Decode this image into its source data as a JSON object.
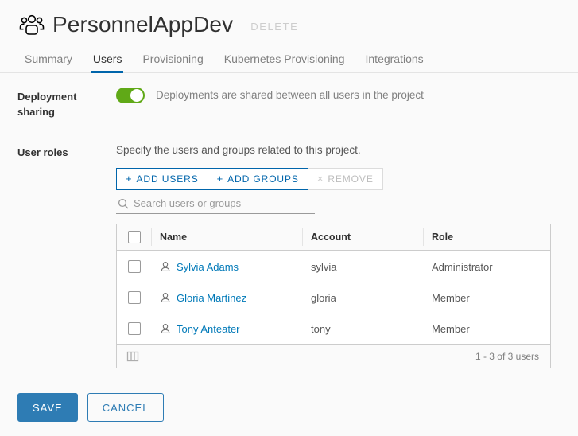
{
  "header": {
    "icon": "group-people-icon",
    "title": "PersonnelAppDev",
    "delete_label": "DELETE"
  },
  "tabs": [
    {
      "label": "Summary",
      "active": false
    },
    {
      "label": "Users",
      "active": true
    },
    {
      "label": "Provisioning",
      "active": false
    },
    {
      "label": "Kubernetes Provisioning",
      "active": false
    },
    {
      "label": "Integrations",
      "active": false
    }
  ],
  "deployment_sharing": {
    "label": "Deployment sharing",
    "toggle_on": true,
    "description": "Deployments are shared between all users in the project"
  },
  "user_roles": {
    "label": "User roles",
    "description": "Specify the users and groups related to this project.",
    "buttons": {
      "add_users": "ADD USERS",
      "add_groups": "ADD GROUPS",
      "remove": "REMOVE",
      "plus_glyph": "+",
      "remove_glyph": "×"
    },
    "search": {
      "placeholder": "Search users or groups",
      "value": ""
    },
    "table": {
      "columns": [
        "Name",
        "Account",
        "Role"
      ],
      "rows": [
        {
          "name": "Sylvia Adams",
          "account": "sylvia",
          "role": "Administrator"
        },
        {
          "name": "Gloria Martinez",
          "account": "gloria",
          "role": "Member"
        },
        {
          "name": "Tony Anteater",
          "account": "tony",
          "role": "Member"
        }
      ],
      "pager": "1 - 3 of 3 users"
    }
  },
  "footer": {
    "save_label": "SAVE",
    "cancel_label": "CANCEL"
  },
  "colors": {
    "accent_blue": "#0065ab",
    "link_blue": "#0079b8",
    "save_blue": "#2e7cb4",
    "toggle_green": "#60a917",
    "page_bg": "#fafafa",
    "disabled_gray": "#bcbcbc"
  }
}
